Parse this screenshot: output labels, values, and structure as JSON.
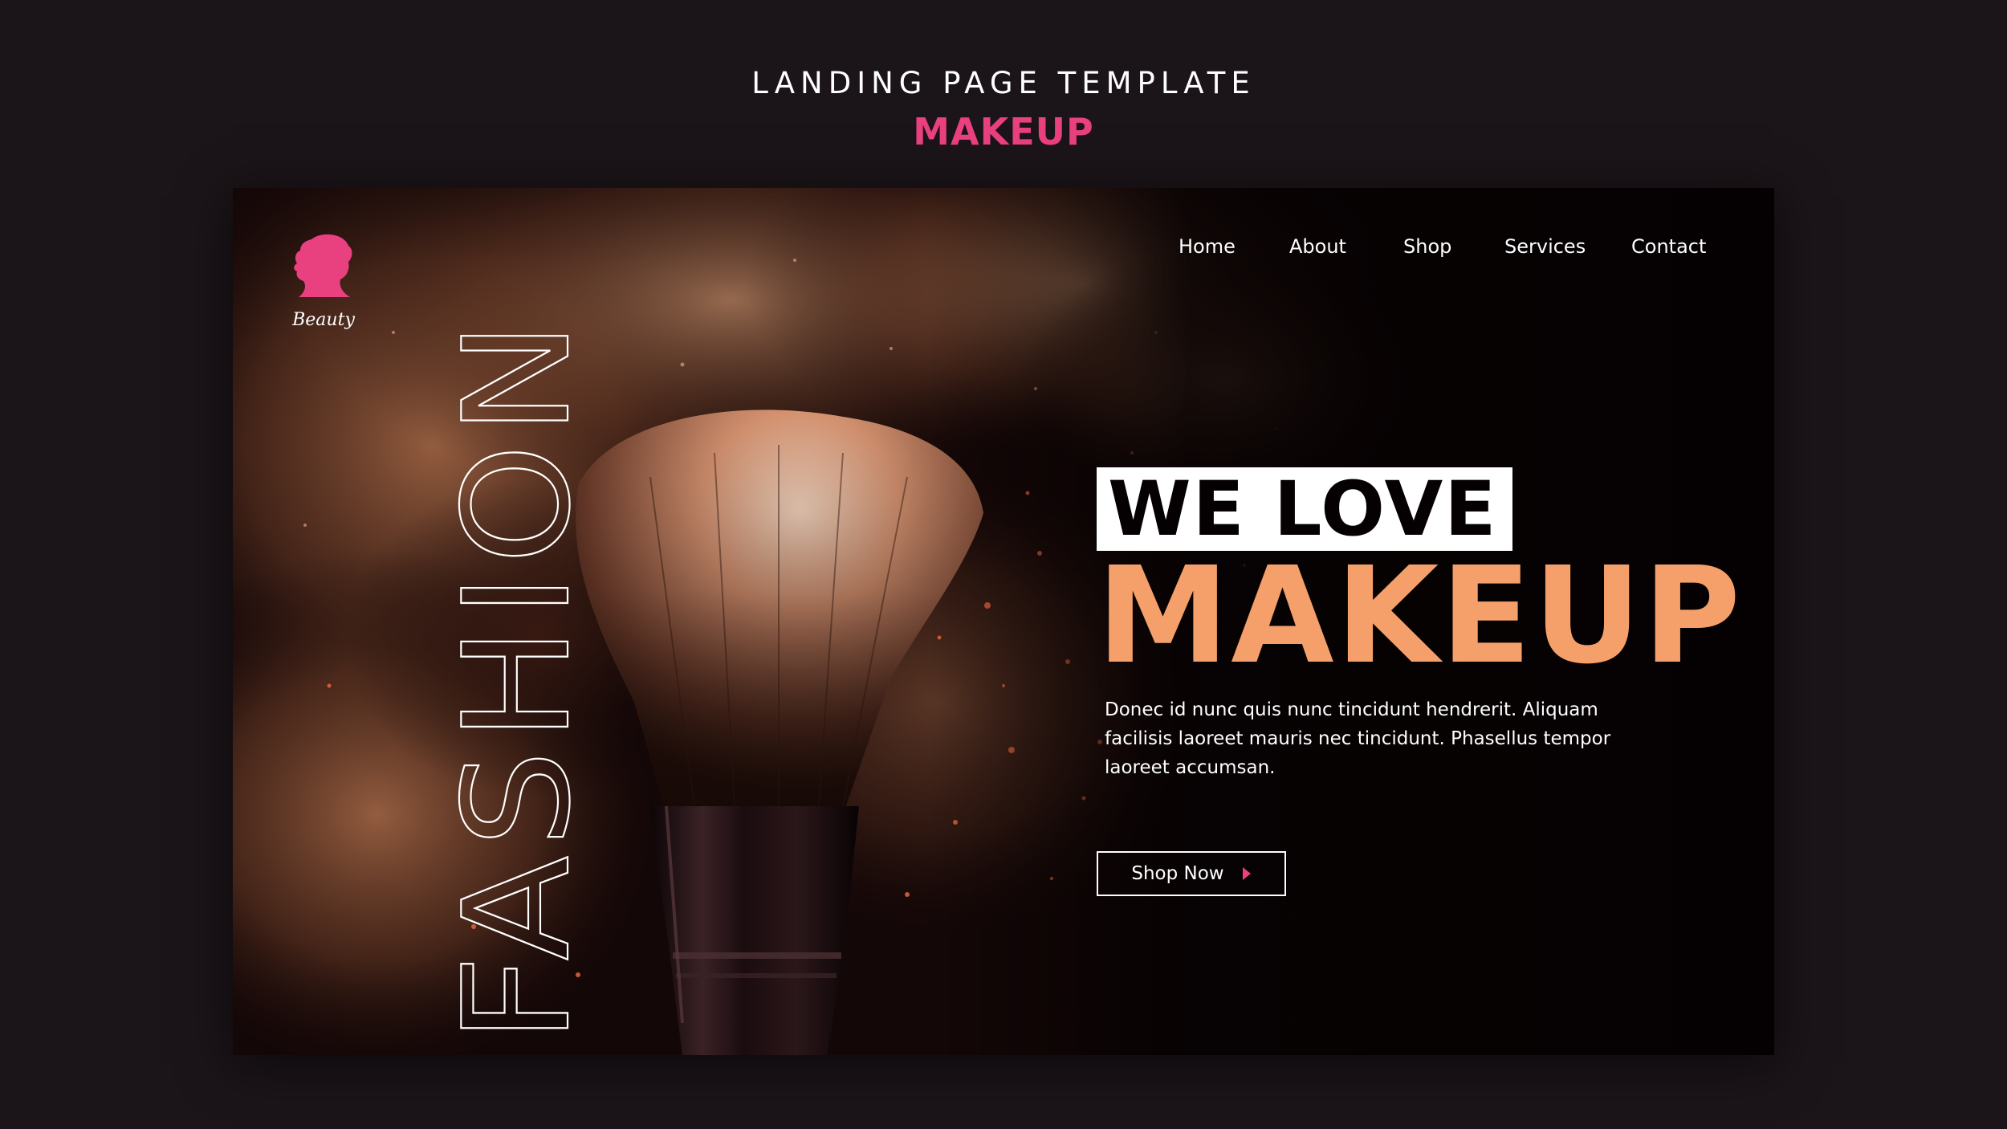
{
  "template": {
    "title": "LANDING PAGE TEMPLATE",
    "subtitle": "MAKEUP"
  },
  "logo": {
    "label": "Beauty",
    "icon": "woman-silhouette-icon",
    "color": "#e9407f"
  },
  "nav": {
    "items": [
      {
        "label": "Home"
      },
      {
        "label": "About"
      },
      {
        "label": "Shop"
      },
      {
        "label": "Services"
      },
      {
        "label": "Contact"
      }
    ]
  },
  "hero": {
    "side_word": "FASHION",
    "tagline": "WE LOVE",
    "headline": "MAKEUP",
    "description": "Donec id nunc quis nunc tincidunt hendrerit. Aliquam facilisis laoreet mauris nec tincidunt. Phasellus tempor laoreet accumsan.",
    "cta": {
      "label": "Shop Now",
      "icon": "caret-right-icon"
    },
    "image": "makeup-brush-with-powder-cloud"
  },
  "colors": {
    "background": "#1b1418",
    "accent_pink": "#e9407f",
    "accent_peach": "#f5a06a",
    "text": "#ffffff"
  }
}
